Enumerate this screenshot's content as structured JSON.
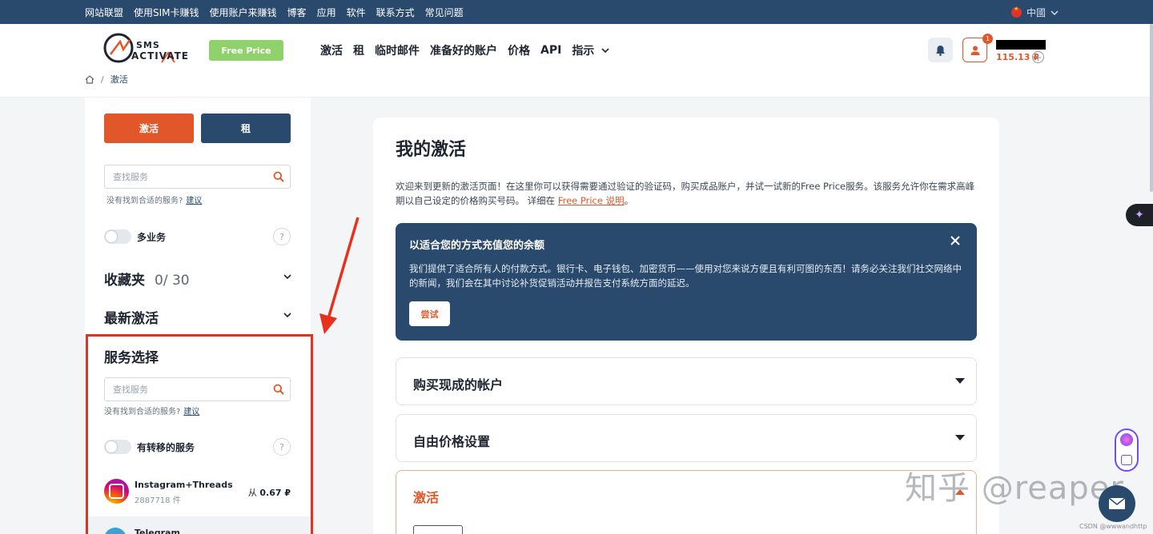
{
  "topbar": {
    "links": [
      "网站联盟",
      "使用SIM卡赚钱",
      "使用账户来赚钱",
      "博客",
      "应用",
      "软件",
      "联系方式",
      "常见问题"
    ],
    "language": "中國"
  },
  "header": {
    "logo_line1": "SMS",
    "logo_line2": "ACTIVATE",
    "free_price_label": "Free Price",
    "nav": [
      "激活",
      "租",
      "临时邮件",
      "准备好的账户",
      "价格",
      "API",
      "指示"
    ],
    "notification_badge": "1",
    "balance": "115.13 ₽"
  },
  "breadcrumb": {
    "current": "激活"
  },
  "sidebar": {
    "activate_label": "激活",
    "rent_label": "租",
    "search_placeholder": "查找服务",
    "not_found_text": "没有找到合适的服务?",
    "suggest_link": "建议",
    "multi_service_label": "多业务",
    "favorites_title": "收藏夹",
    "favorites_count": "0/ 30",
    "recent_title": "最新激活",
    "service_select_title": "服务选择",
    "search2_placeholder": "查找服务",
    "not_found_text2": "没有找到合适的服务?",
    "suggest_link2": "建议",
    "transfer_label": "有转移的服务",
    "help_mark": "?",
    "services": [
      {
        "name": "Instagram+Threads",
        "count": "2887718 件",
        "price_prefix": "从",
        "price": "0.67 ₽"
      }
    ],
    "next_service_partial": "Telegram"
  },
  "main": {
    "title": "我的激活",
    "intro_text": "欢迎来到更新的激活页面！在这里你可以获得需要通过验证的验证码，购买成品账户，并试一试新的Free Price服务。该服务允许你在需求高峰期以自己设定的价格购买号码。 详细在 ",
    "intro_link": "Free Price 说明",
    "intro_end": "。",
    "promo": {
      "title": "以适合您的方式充值您的余额",
      "text": "我们提供了适合所有人的付款方式。银行卡、电子钱包、加密货币——使用对您来说方便且有利可图的东西！请务必关注我们社交网络中的新闻，我们会在其中讨论补货促销活动并报告支付系统方面的延迟。",
      "button": "尝试"
    },
    "accordions": [
      {
        "label": "购买现成的帐户"
      },
      {
        "label": "自由价格设置"
      },
      {
        "label": "激活"
      }
    ]
  },
  "watermark": "知乎 @reaper",
  "csdn_mark": "CSDN @wwwandhttp",
  "colors": {
    "primary": "#2a4a6d",
    "accent": "#e2572a",
    "free_price": "#8fd16b",
    "annotation_red": "#e8301f"
  }
}
